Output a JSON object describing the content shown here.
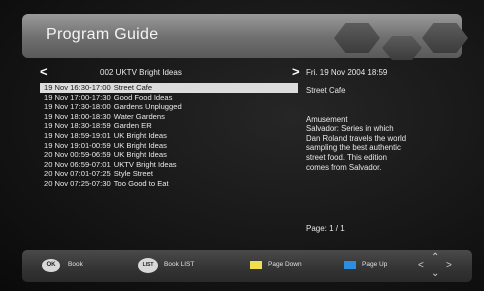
{
  "header": {
    "title": "Program Guide"
  },
  "channel": {
    "name": "002 UKTV Bright Ideas",
    "date": "Fri. 19 Nov 2004 18:59"
  },
  "programs": [
    {
      "time": "19 Nov 16:30-17:00",
      "title": "Street Cafe",
      "selected": true
    },
    {
      "time": "19 Nov 17:00-17:30",
      "title": "Good Food Ideas",
      "selected": false
    },
    {
      "time": "19 Nov 17:30-18:00",
      "title": "Gardens Unplugged",
      "selected": false
    },
    {
      "time": "19 Nov 18:00-18:30",
      "title": "Water Gardens",
      "selected": false
    },
    {
      "time": "19 Nov 18:30-18:59",
      "title": "Garden ER",
      "selected": false
    },
    {
      "time": "19 Nov 18:59-19:01",
      "title": "UK Bright Ideas",
      "selected": false
    },
    {
      "time": "19 Nov 19:01-00:59",
      "title": "UK Bright Ideas",
      "selected": false
    },
    {
      "time": "20 Nov 00:59-06:59",
      "title": "UK Bright Ideas",
      "selected": false
    },
    {
      "time": "20 Nov 06:59-07:01",
      "title": "UKTV Bright Ideas",
      "selected": false
    },
    {
      "time": "20 Nov 07:01-07:25",
      "title": "Style Street",
      "selected": false
    },
    {
      "time": "20 Nov 07:25-07:30",
      "title": "Too Good to Eat",
      "selected": false
    }
  ],
  "detail": {
    "title": "Street Cafe",
    "description": "Amusement\nSalvador: Series in which\nDan Roland travels the world\nsampling the best authentic\nstreet food. This edition\ncomes from Salvador.",
    "page": "Page:  1 / 1"
  },
  "footer": {
    "ok_icon": "OK",
    "ok_label": "Book",
    "list_icon": "LIST",
    "list_label": "Book LIST",
    "yellow_label": "Page Down",
    "blue_label": "Page Up"
  },
  "colors": {
    "yellow_key": "#f0e050",
    "blue_key": "#2c8ee0",
    "selection": "#dcdcdc"
  }
}
